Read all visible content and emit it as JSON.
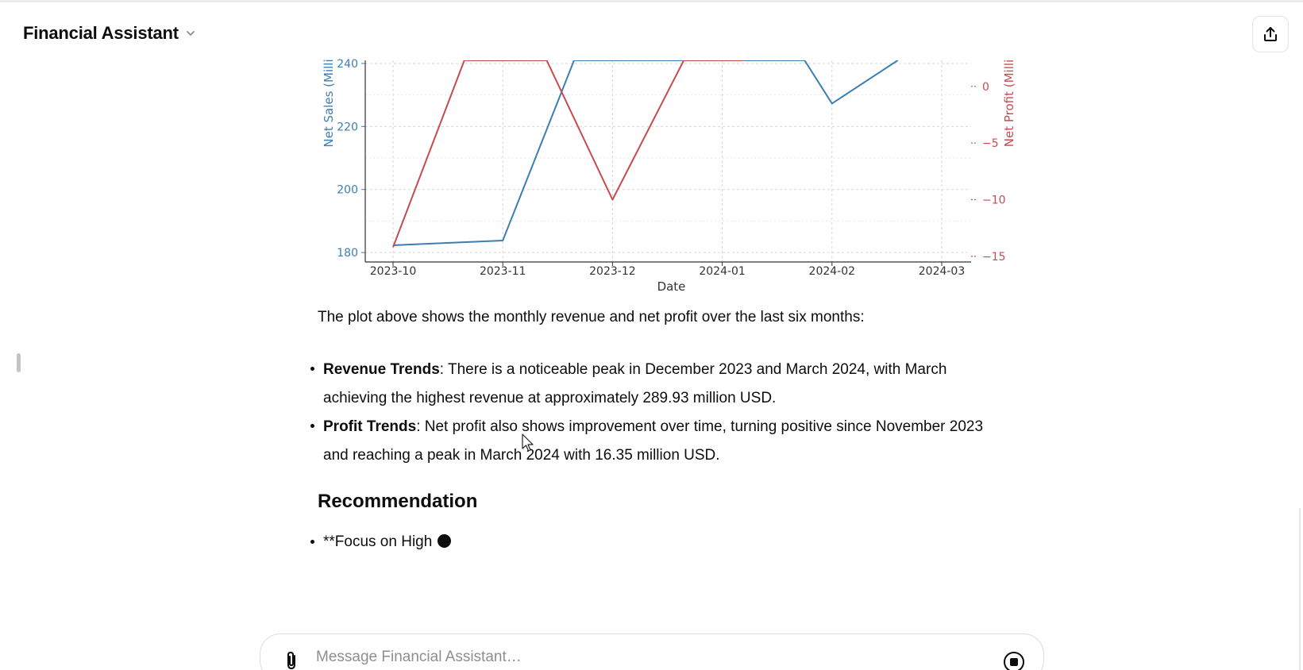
{
  "header": {
    "model_name": "Financial Assistant",
    "share_icon": "share-icon"
  },
  "chart_data": {
    "type": "line",
    "xlabel": "Date",
    "y_left_label": "Net Sales (Milli",
    "y_right_label": "Net Profit (Milli",
    "x_ticks": [
      "2023-10",
      "2023-11",
      "2023-12",
      "2024-01",
      "2024-02",
      "2024-03"
    ],
    "y_left_ticks": [
      180,
      200,
      220,
      240
    ],
    "y_right_ticks": [
      0,
      -5,
      -10,
      -15
    ],
    "y_left_range": [
      177,
      241
    ],
    "y_right_range": [
      -15.5,
      2.3
    ],
    "grid": true,
    "series": [
      {
        "axis": "left",
        "color": "#3b7eb0",
        "x": [
          0,
          1,
          1.65,
          2.65,
          3.75,
          4,
          4.6
        ],
        "y": [
          182.3,
          183.8,
          241,
          241,
          241,
          227.3,
          241
        ]
      },
      {
        "axis": "right",
        "color": "#c64b4f",
        "x": [
          0,
          0.65,
          1.4,
          2,
          2.65,
          3.2
        ],
        "y": [
          -14.2,
          2.3,
          2.3,
          -10.0,
          2.3,
          2.3
        ]
      }
    ]
  },
  "message": {
    "intro": "The plot above shows the monthly revenue and net profit over the last six months:",
    "bullets": [
      {
        "bold": "Revenue Trends",
        "text": ": There is a noticeable peak in December 2023 and March 2024, with March achieving the highest revenue at approximately 289.93 million USD."
      },
      {
        "bold": "Profit Trends",
        "text": ": Net profit also shows improvement over time, turning positive since November 2023 and reaching a peak in March 2024 with 16.35 million USD."
      }
    ],
    "recommendation_title": "Recommendation",
    "recommendation_items": [
      "**Focus on High"
    ]
  },
  "composer": {
    "placeholder": "Message Financial Assistant…",
    "attach_icon": "paperclip-icon",
    "stop_icon": "stop-icon"
  }
}
